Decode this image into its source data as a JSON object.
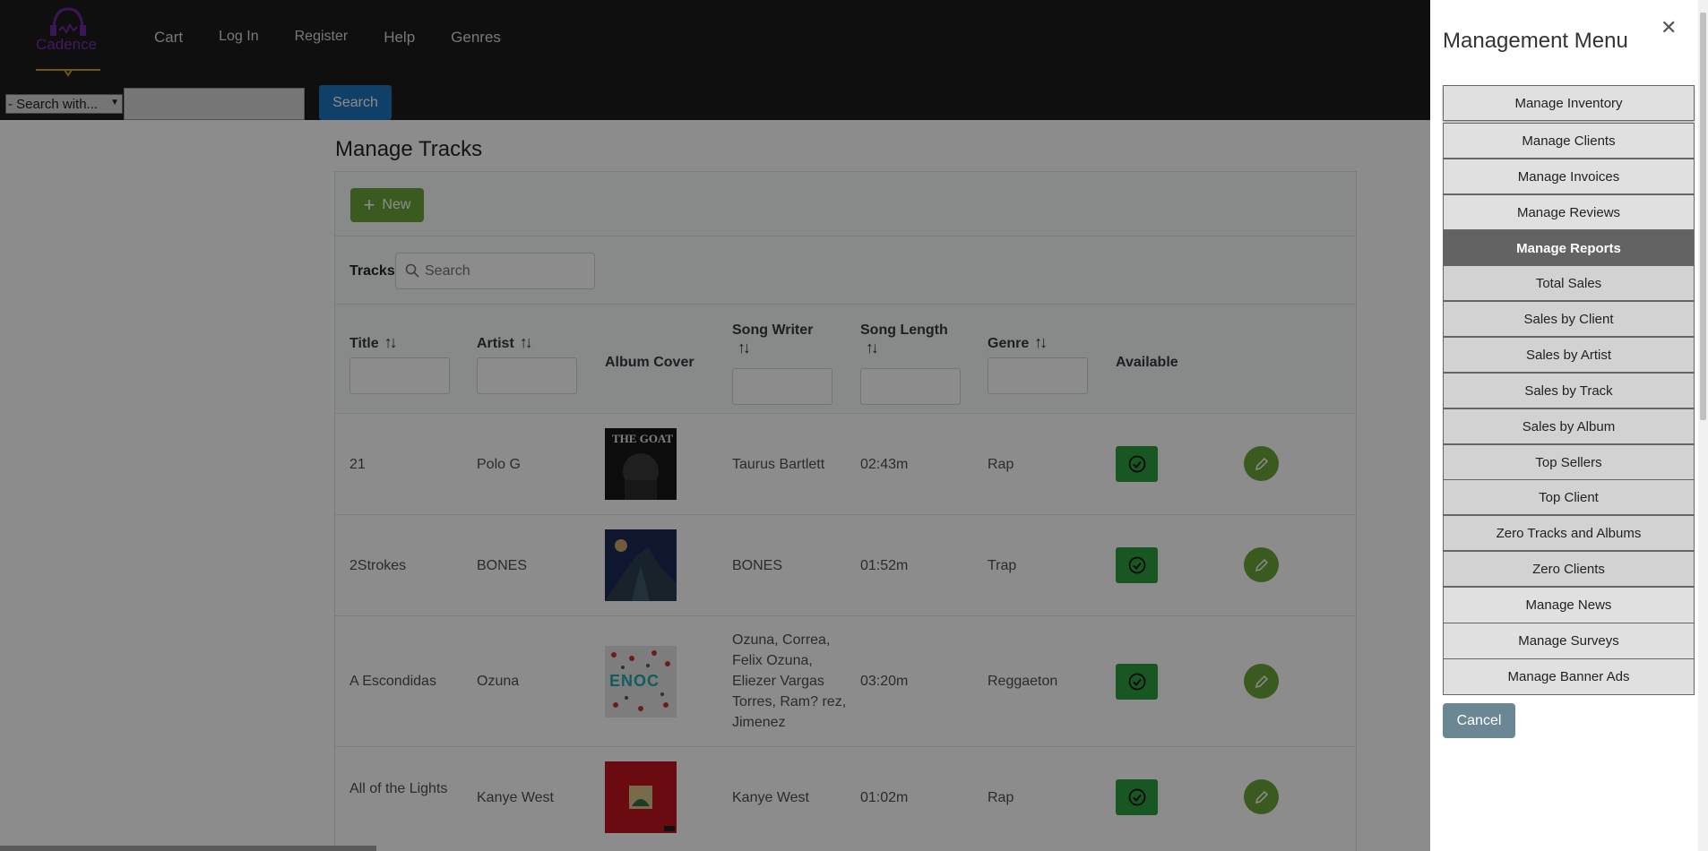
{
  "header": {
    "logo_text": "Cadence",
    "nav": [
      "Cart",
      "Log In",
      "Register",
      "Help",
      "Genres"
    ],
    "search_select": "- Search with...",
    "search_value": "",
    "search_button": "Search"
  },
  "main": {
    "title": "Manage Tracks",
    "new_button": "New",
    "tracks_label": "Tracks",
    "tracks_search_placeholder": "Search",
    "columns": {
      "title": "Title",
      "artist": "Artist",
      "album_cover": "Album Cover",
      "song_writer": "Song Writer",
      "song_length": "Song Length",
      "genre": "Genre",
      "available": "Available"
    },
    "rows": [
      {
        "title": "21",
        "artist": "Polo G",
        "cover": "THE GOAT",
        "writer": "Taurus Bartlett",
        "length": "02:43m",
        "genre": "Rap"
      },
      {
        "title": "2Strokes",
        "artist": "BONES",
        "cover": "",
        "writer": "BONES",
        "length": "01:52m",
        "genre": "Trap"
      },
      {
        "title": "A Escondidas",
        "artist": "Ozuna",
        "cover": "ENOC",
        "writer": "Ozuna, Correa, Felix Ozuna, Eliezer Vargas Torres, Ram? rez, Jimenez",
        "length": "03:20m",
        "genre": "Reggaeton"
      },
      {
        "title": "All of the Lights",
        "artist": "Kanye West",
        "cover": "",
        "writer": "Kanye West",
        "length": "01:02m",
        "genre": "Rap"
      }
    ]
  },
  "side_menu": {
    "title": "Management Menu",
    "close_icon": "close-icon",
    "items": [
      "Manage Inventory",
      "Manage Clients",
      "Manage Invoices",
      "Manage Reviews",
      "Manage Reports",
      "Total Sales",
      "Sales by Client",
      "Sales by Artist",
      "Sales by Track",
      "Sales by Album",
      "Top Sellers",
      "Top Client",
      "Zero Tracks and Albums",
      "Zero Clients",
      "Manage News",
      "Manage Surveys",
      "Manage Banner Ads"
    ],
    "active_item": "Manage Reports",
    "cancel_button": "Cancel"
  },
  "colors": {
    "header_bg": "#1c1c1c",
    "accent_green": "#6ba539",
    "available_green": "#2e9e3f",
    "search_blue": "#1e73be",
    "active_menu": "#636363",
    "cancel": "#6c8794"
  }
}
